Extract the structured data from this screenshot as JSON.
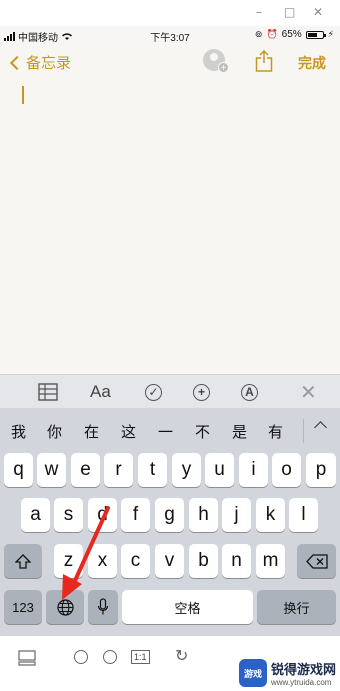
{
  "window_controls": [
    "–",
    "□",
    "✕"
  ],
  "status_bar": {
    "carrier": "中国移动",
    "time": "下午3:07",
    "battery": "65%",
    "battery_level": 0.65
  },
  "nav": {
    "back_label": "备忘录",
    "done_label": "完成",
    "icons": [
      "add-person-icon",
      "share-icon"
    ]
  },
  "format_toolbar": {
    "items": [
      "table-icon",
      "Aa",
      "checklist-icon",
      "add-icon",
      "markup-icon",
      "close-icon"
    ],
    "text_style_label": "Aa"
  },
  "candidates": [
    "我",
    "你",
    "在",
    "这",
    "一",
    "不",
    "是",
    "有"
  ],
  "keyboard": {
    "row1": [
      "q",
      "w",
      "e",
      "r",
      "t",
      "y",
      "u",
      "i",
      "o",
      "p"
    ],
    "row2": [
      "a",
      "s",
      "d",
      "f",
      "g",
      "h",
      "j",
      "k",
      "l"
    ],
    "row3": [
      "z",
      "x",
      "c",
      "v",
      "b",
      "n",
      "m"
    ],
    "numbers_label": "123",
    "space_label": "空格",
    "return_label": "换行",
    "icons": [
      "shift-icon",
      "delete-icon",
      "globe-icon",
      "microphone-icon"
    ]
  },
  "bottom_bar": {
    "icons": [
      "layout-icon",
      "zoom-in-icon",
      "zoom-out-icon",
      "actual-size-icon",
      "rotate-icon"
    ],
    "actual_size_label": "1:1"
  },
  "watermark": {
    "logo_text": "游戏",
    "title": "锐得游戏网",
    "url": "www.ytruida.com"
  },
  "colors": {
    "accent": "#c8961c",
    "keyboard_bg": "#d2d5db",
    "dark_key": "#acb2bc",
    "annotation_arrow": "#e8281f"
  }
}
